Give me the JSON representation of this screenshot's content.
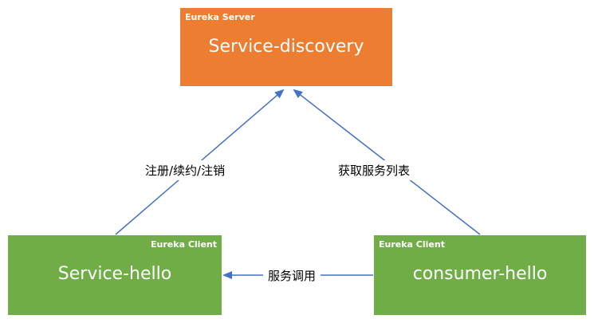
{
  "server": {
    "tag": "Eureka Server",
    "title": "Service-discovery",
    "color": "#ed7d31"
  },
  "client_left": {
    "tag": "Eureka Client",
    "title": "Service-hello",
    "color": "#70ad47"
  },
  "client_right": {
    "tag": "Eureka Client",
    "title": "consumer-hello",
    "color": "#70ad47"
  },
  "edges": {
    "register": "注册/续约/注销",
    "fetch": "获取服务列表",
    "invoke": "服务调用"
  },
  "arrow_color": "#4472c4"
}
